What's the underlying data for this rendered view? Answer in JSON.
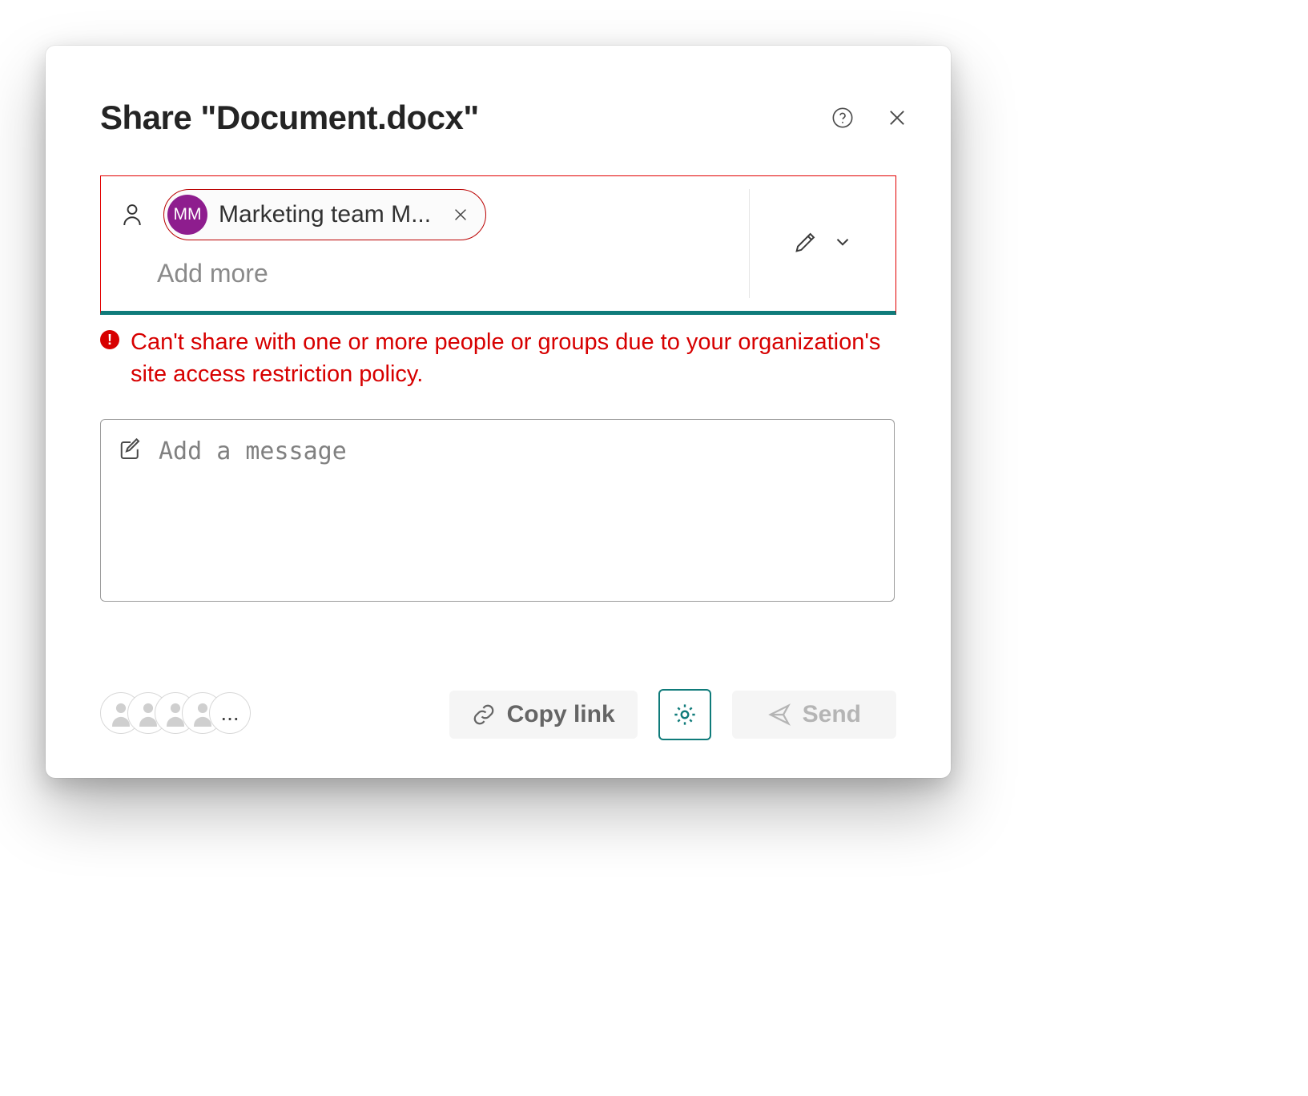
{
  "dialog": {
    "title": "Share \"Document.docx\""
  },
  "recipients": {
    "chip": {
      "initials": "MM",
      "label": "Marketing team M...",
      "avatar_color": "#8e1d8e"
    },
    "add_more_placeholder": "Add more"
  },
  "error": {
    "text": "Can't share with one or more people or groups due to your organization's site access restriction policy."
  },
  "message": {
    "placeholder": "Add a message"
  },
  "footer": {
    "copy_link_label": "Copy link",
    "send_label": "Send",
    "shared_with_more": "..."
  },
  "colors": {
    "error": "#d70000",
    "accent_teal": "#0f7b7a",
    "chip_border": "#ba0000"
  }
}
